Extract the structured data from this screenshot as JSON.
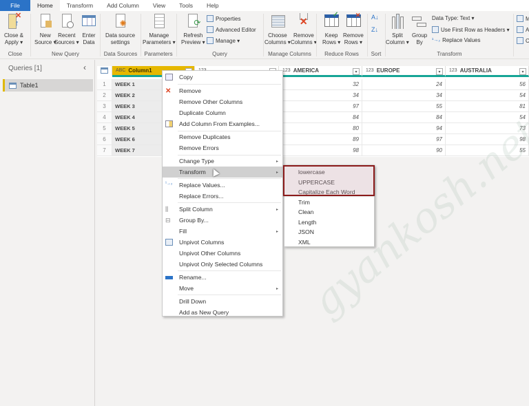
{
  "tabs": [
    "File",
    "Home",
    "Transform",
    "Add Column",
    "View",
    "Tools",
    "Help"
  ],
  "active_tab": "Home",
  "ribbon": {
    "close": {
      "btn": [
        "Close &",
        "Apply ▾"
      ],
      "label": "Close"
    },
    "new_query": {
      "buttons": [
        [
          "New",
          "Source ▾"
        ],
        [
          "Recent",
          "Sources ▾"
        ],
        [
          "Enter",
          "Data"
        ]
      ],
      "label": "New Query"
    },
    "data_sources": {
      "btn": [
        "Data source",
        "settings"
      ],
      "label": "Data Sources"
    },
    "parameters": {
      "btn": [
        "Manage",
        "Parameters ▾"
      ],
      "label": "Parameters"
    },
    "query": {
      "btn": [
        "Refresh",
        "Preview ▾"
      ],
      "small": [
        "Properties",
        "Advanced Editor",
        "Manage ▾"
      ],
      "label": "Query"
    },
    "manage_columns": {
      "buttons": [
        [
          "Choose",
          "Columns ▾"
        ],
        [
          "Remove",
          "Columns ▾"
        ]
      ],
      "label": "Manage Columns"
    },
    "reduce_rows": {
      "buttons": [
        [
          "Keep",
          "Rows ▾"
        ],
        [
          "Remove",
          "Rows ▾"
        ]
      ],
      "label": "Reduce Rows"
    },
    "sort": {
      "label": "Sort",
      "icons": [
        "sort-ascending-icon",
        "sort-descending-icon"
      ]
    },
    "transform": {
      "buttons": [
        [
          "Split",
          "Column ▾"
        ],
        [
          "Group",
          "By"
        ]
      ],
      "small": [
        "Data Type: Text ▾",
        "Use First Row as Headers ▾",
        "Replace Values"
      ],
      "label": "Transform"
    },
    "combine": {
      "small": [
        "M",
        "A",
        "C"
      ]
    }
  },
  "queries": {
    "title": "Queries [1]",
    "collapse": "‹",
    "items": [
      "Table1"
    ]
  },
  "table": {
    "columns": [
      {
        "name": "Column1",
        "type": "ABC"
      },
      {
        "name": "",
        "type": "123"
      },
      {
        "name": "AMERICA",
        "type": "123"
      },
      {
        "name": "EUROPE",
        "type": "123"
      },
      {
        "name": "AUSTRALIA",
        "type": "123"
      }
    ],
    "rows": [
      {
        "n": "1",
        "c1": "WEEK 1",
        "america": "32",
        "europe": "24",
        "australia": "56"
      },
      {
        "n": "2",
        "c1": "WEEK 2",
        "america": "34",
        "europe": "34",
        "australia": "54"
      },
      {
        "n": "3",
        "c1": "WEEK 3",
        "america": "97",
        "europe": "55",
        "australia": "81"
      },
      {
        "n": "4",
        "c1": "WEEK 4",
        "america": "84",
        "europe": "84",
        "australia": "54"
      },
      {
        "n": "5",
        "c1": "WEEK 5",
        "america": "80",
        "europe": "94",
        "australia": "73"
      },
      {
        "n": "6",
        "c1": "WEEK 6",
        "america": "89",
        "europe": "97",
        "australia": "98"
      },
      {
        "n": "7",
        "c1": "WEEK 7",
        "america": "98",
        "europe": "90",
        "australia": "55"
      }
    ]
  },
  "context_menu": {
    "items": [
      "Copy",
      "Remove",
      "Remove Other Columns",
      "Duplicate Column",
      "Add Column From Examples...",
      "Remove Duplicates",
      "Remove Errors",
      "Change Type",
      "Transform",
      "Replace Values...",
      "Replace Errors...",
      "Split Column",
      "Group By...",
      "Fill",
      "Unpivot Columns",
      "Unpivot Other Columns",
      "Unpivot Only Selected Columns",
      "Rename...",
      "Move",
      "Drill Down",
      "Add as New Query"
    ],
    "highlighted": "Transform"
  },
  "transform_submenu": {
    "items": [
      "lowercase",
      "UPPERCASE",
      "Capitalize Each Word",
      "Trim",
      "Clean",
      "Length",
      "JSON",
      "XML"
    ],
    "highlighted_group": [
      "lowercase",
      "UPPERCASE",
      "Capitalize Each Word"
    ]
  },
  "watermark": "gyankosh.net",
  "colors": {
    "file_tab": "#2b73c7",
    "selected_column": "#e6b800",
    "header_underline": "#16a596",
    "highlight_box": "#8b1a1a"
  }
}
